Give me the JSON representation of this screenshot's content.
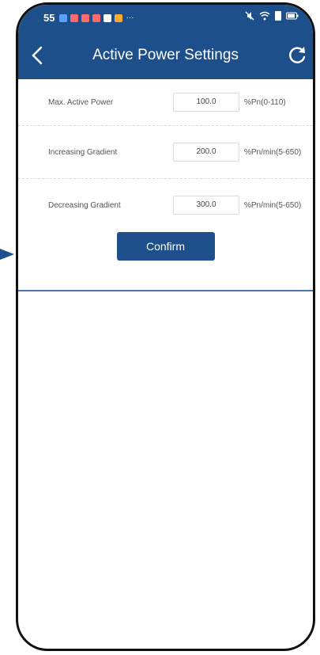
{
  "status": {
    "time": "55",
    "notification_colors": [
      "#5aa0ff",
      "#ff6b6b",
      "#ff6b6b",
      "#ff6b6b",
      "#ffffff",
      "#ffaa33"
    ],
    "dots": "···"
  },
  "header": {
    "title": "Active Power Settings",
    "back_icon": "chevron-left-icon",
    "refresh_icon": "refresh-icon",
    "color": "#1d4f8a"
  },
  "settings": [
    {
      "label": "Max. Active Power",
      "value": "100.0",
      "unit": "%Pn(0-110)"
    },
    {
      "label": "Increasing Gradient",
      "value": "200.0",
      "unit": "%Pn/min(5-650)"
    },
    {
      "label": "Decreasing Gradient",
      "value": "300.0",
      "unit": "%Pn/min(5-650)"
    }
  ],
  "confirm_label": "Confirm"
}
